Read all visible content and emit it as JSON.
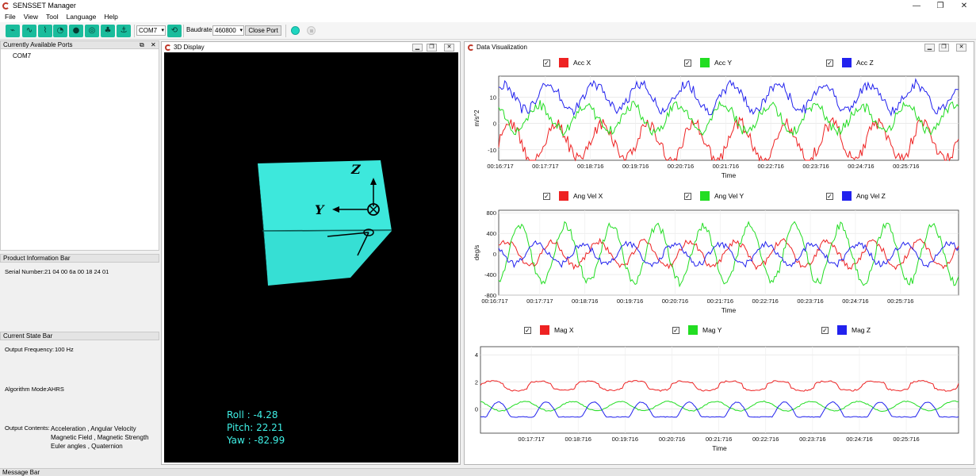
{
  "window": {
    "title": "SENSSET Manager",
    "min": "—",
    "max": "❐",
    "close": "✕"
  },
  "menu": [
    "File",
    "View",
    "Tool",
    "Language",
    "Help"
  ],
  "toolbar": {
    "icons": [
      "sensor-icon",
      "waveform-icon",
      "heartbeat-icon",
      "speedometer-icon",
      "location-pin-icon",
      "compass-icon",
      "bulb-icon",
      "anchor-icon"
    ],
    "port": "COM7",
    "baudrate_label": "Baudrate:",
    "baudrate": "460800",
    "close_port": "Close Port",
    "colors": {
      "accent": "#1abc9c",
      "led_on": "#1fd6c0",
      "led_off": "#d0d0d0"
    }
  },
  "left": {
    "ports_title": "Currently Available Ports",
    "ports": [
      "COM7"
    ],
    "product_title": "Product Information Bar",
    "serial_label": "Serial Number:",
    "serial": "21 04 00 6a 00 18 24 01",
    "state_title": "Current State Bar",
    "freq_label": "Output Frequency:",
    "freq": "100 Hz",
    "algo_label": "Algorithm Mode:",
    "algo": "AHRS",
    "contents_label": "Output Contents:",
    "contents": [
      "Acceleration , Angular Velocity",
      "Magnetic Field , Magnetic Strength",
      "Euler angles , Quaternion"
    ]
  },
  "display3d": {
    "title": "3D Display",
    "roll": "Roll  :  -4.28",
    "pitch": "Pitch:  22.21",
    "yaw": "Yaw  :  -82.99",
    "axis_z": "Z",
    "axis_y": "Y",
    "cube_color": "#3de8dc"
  },
  "dataviz": {
    "title": "Data Visualization",
    "charts": [
      {
        "legend": [
          "Acc X",
          "Acc Y",
          "Acc Z"
        ],
        "ylabel": "m/s^2",
        "xlabel": "Time",
        "yticks": [
          "10",
          "0",
          "-10"
        ]
      },
      {
        "legend": [
          "Ang Vel X",
          "Ang Vel Y",
          "Ang Vel Z"
        ],
        "ylabel": "deg/s",
        "xlabel": "Time",
        "yticks": [
          "800",
          "400",
          "0",
          "-400",
          "-800"
        ]
      },
      {
        "legend": [
          "Mag X",
          "Mag Y",
          "Mag Z"
        ],
        "ylabel": "",
        "xlabel": "Time",
        "yticks": [
          "4",
          "2",
          "0"
        ]
      }
    ],
    "xticks1": [
      "00:16:717",
      "00:17:717",
      "00:18:716",
      "00:19:716",
      "00:20:716",
      "00:21:716",
      "00:22:716",
      "00:23:716",
      "00:24:716",
      "00:25:716"
    ],
    "xticks2": [
      "00:16:717",
      "00:17:717",
      "00:18:716",
      "00:19:716",
      "00:20:716",
      "00:21:716",
      "00:22:716",
      "00:23:716",
      "00:24:716",
      "00:25:716"
    ],
    "xticks3": [
      "00:17:717",
      "00:18:716",
      "00:19:716",
      "00:20:716",
      "00:21:716",
      "00:22:716",
      "00:23:716",
      "00:24:716",
      "00:25:716"
    ],
    "series_colors": [
      "#ee2222",
      "#22dd22",
      "#2222ee"
    ]
  },
  "message_bar": "Message Bar"
}
